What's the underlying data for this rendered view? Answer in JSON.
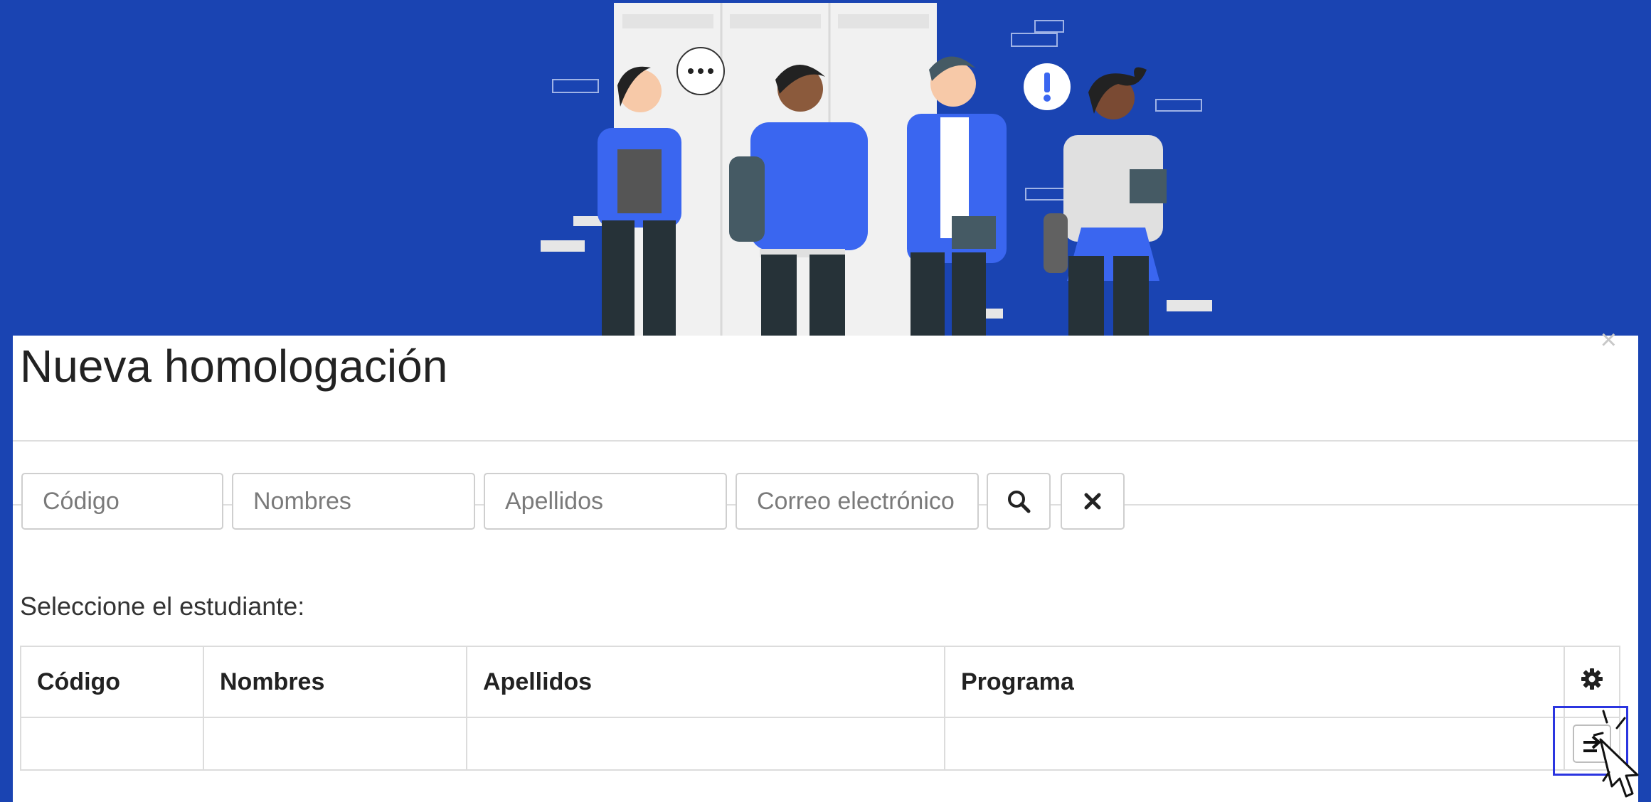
{
  "modal": {
    "title": "Nueva homologación",
    "close_symbol": "×"
  },
  "filters": {
    "codigo_placeholder": "Código",
    "nombres_placeholder": "Nombres",
    "apellidos_placeholder": "Apellidos",
    "correo_placeholder": "Correo electrónico",
    "search_icon": "search-icon",
    "clear_icon": "close-icon"
  },
  "prompt": "Seleccione el estudiante:",
  "table": {
    "columns": [
      "Código",
      "Nombres",
      "Apellidos",
      "Programa"
    ],
    "settings_icon": "gear-icon",
    "rows": [
      {
        "codigo": "",
        "nombres": "",
        "apellidos": "",
        "programa": "",
        "action_icon": "arrow-right-icon"
      }
    ]
  },
  "colors": {
    "hero_background": "#1a44b2",
    "accent_blue": "#3a66f0",
    "highlight_border": "#2b35e0"
  }
}
